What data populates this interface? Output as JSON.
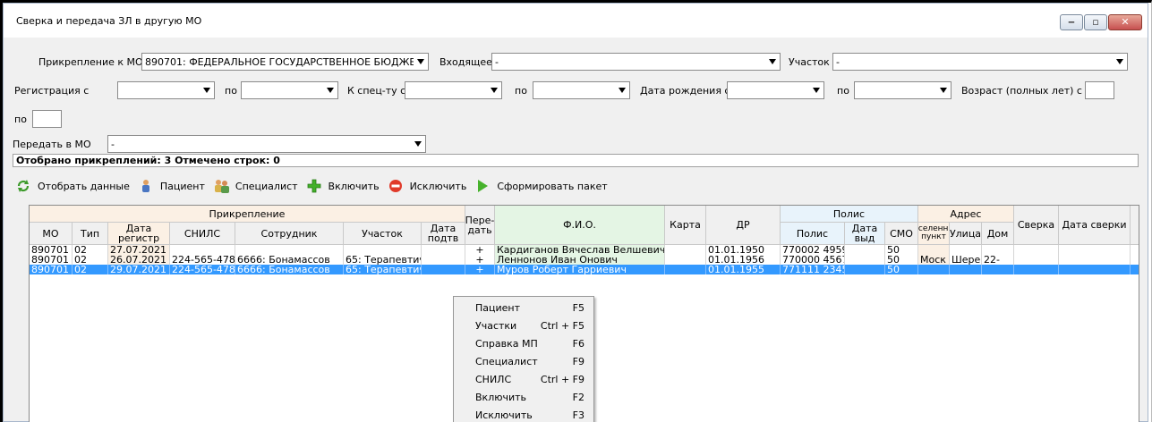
{
  "window": {
    "title": "Сверка и передача ЗЛ в другую МО",
    "buttons": {
      "minimize": "‒",
      "maximize": "▫",
      "close": "✕"
    }
  },
  "filters": {
    "attach_mo_label": "Прикрепление к МО",
    "attach_mo_value": "890701: ФЕДЕРАЛЬНОЕ ГОСУДАРСТВЕННОЕ БЮДЖЕ",
    "incoming_label": "Входящее",
    "incoming_value": "-",
    "district_label": "Участок",
    "district_value": "-",
    "reg_from_label": "Регистрация с",
    "reg_to_label": "по",
    "spec_from_label": "К спец-ту с",
    "spec_to_label": "по",
    "birth_from_label": "Дата рождения с",
    "birth_to_label": "по",
    "age_from_label": "Возраст (полных лет) с",
    "age_to_label": "по",
    "transfer_mo_label": "Передать в МО",
    "transfer_mo_value": "-"
  },
  "status": {
    "text": "Отобрано прикреплений: 3  Отмечено строк: 0"
  },
  "toolbar": {
    "fetch": "Отобрать данные",
    "patient": "Пациент",
    "specialist": "Специалист",
    "include": "Включить",
    "exclude": "Исключить",
    "build_package": "Сформировать пакет"
  },
  "grid": {
    "groups": {
      "attachment": "Прикрепление",
      "policy": "Полис",
      "address": "Адрес"
    },
    "columns": {
      "mo": "МО",
      "type": "Тип",
      "reg_date": "Дата регистр",
      "snils": "СНИЛС",
      "employee": "Сотрудник",
      "district": "Участок",
      "confirm_date": "Дата подтв",
      "transfer": "Пере-дать",
      "fio": "Ф.И.О.",
      "card": "Карта",
      "dob": "ДР",
      "policy": "Полис",
      "issue_date": "Дата выд",
      "smo": "СМО",
      "settlement": "Населенный пункт",
      "street": "Улица",
      "house": "Дом",
      "check": "Сверка",
      "check_date": "Дата сверки"
    },
    "rows": [
      {
        "mo": "890701",
        "type": "02",
        "reg_date": "27.07.2021",
        "snils": "",
        "employee": "",
        "district": "",
        "confirm_date": "",
        "transfer": "+",
        "fio": "Кардиганов Вячеслав Велшевич",
        "card": "",
        "dob": "01.01.1950",
        "policy": "770002 4959",
        "issue_date": "",
        "smo": "50",
        "settlement": "",
        "street": "",
        "house": "",
        "check": "",
        "check_date": ""
      },
      {
        "mo": "890701",
        "type": "02",
        "reg_date": "26.07.2021",
        "snils": "224-565-478 3",
        "employee": "6666: Бонамассов",
        "district": "65: Терапевтич",
        "confirm_date": "",
        "transfer": "+",
        "fio": "Леннонов Иван Онович",
        "card": "",
        "dob": "01.01.1956",
        "policy": "770000 4567",
        "issue_date": "",
        "smo": "50",
        "settlement": "Моск",
        "street": "Шере",
        "house": "22-",
        "check": "",
        "check_date": ""
      },
      {
        "mo": "890701",
        "type": "02",
        "reg_date": "29.07.2021",
        "snils": "224-565-478 3",
        "employee": "6666: Бонамассов",
        "district": "65: Терапевтич",
        "confirm_date": "",
        "transfer": "+",
        "fio": "Муров Роберт Гарриевич",
        "card": "",
        "dob": "01.01.1955",
        "policy": "771111 2345",
        "issue_date": "",
        "smo": "50",
        "settlement": "",
        "street": "",
        "house": "",
        "check": "",
        "check_date": ""
      }
    ]
  },
  "context_menu": {
    "items": [
      {
        "label": "Пациент",
        "key": "F5"
      },
      {
        "label": "Участки",
        "key": "Ctrl + F5"
      },
      {
        "label": "Справка МП",
        "key": "F6"
      },
      {
        "label": "Специалист",
        "key": "F9"
      },
      {
        "label": "СНИЛС",
        "key": "Ctrl + F9"
      },
      {
        "label": "Включить",
        "key": "F2"
      },
      {
        "label": "Исключить",
        "key": "F3"
      }
    ]
  },
  "colors": {
    "selection": "#3399ff",
    "attachment_header": "#fbf0e4",
    "fio_header": "#e4f5e4",
    "policy_header": "#e8f3fb"
  }
}
